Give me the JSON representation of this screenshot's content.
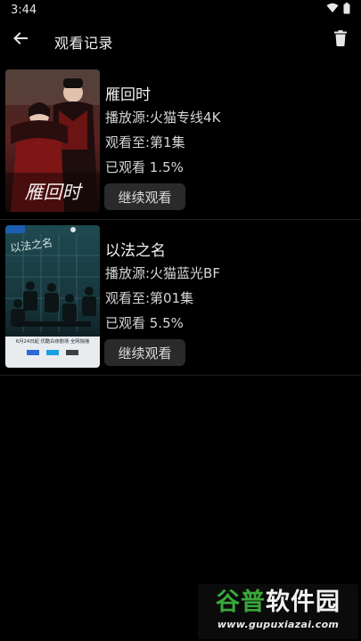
{
  "status_bar": {
    "time": "3:44"
  },
  "app_bar": {
    "title": "观看记录",
    "back_icon": "arrow-left-icon",
    "delete_icon": "trash-icon"
  },
  "history": [
    {
      "title": "雁回时",
      "source": "播放源:火猫专线4K",
      "episode": "观看至:第1集",
      "progress": "已观看 1.5%",
      "progress_percent": 1.5,
      "button": "继续观看",
      "poster_text": "雁回时"
    },
    {
      "title": "以法之名",
      "source": "播放源:火猫蓝光BF",
      "episode": "观看至:第01集",
      "progress": "已观看 5.5%",
      "progress_percent": 5.5,
      "button": "继续观看",
      "poster_text": "以法之名",
      "poster_date": "6月24日起 优酷白夜剧场 全网独播"
    }
  ],
  "watermark": {
    "main_green": "谷普",
    "main_white": "软件园",
    "url": "www.gupuxiazai.com"
  }
}
